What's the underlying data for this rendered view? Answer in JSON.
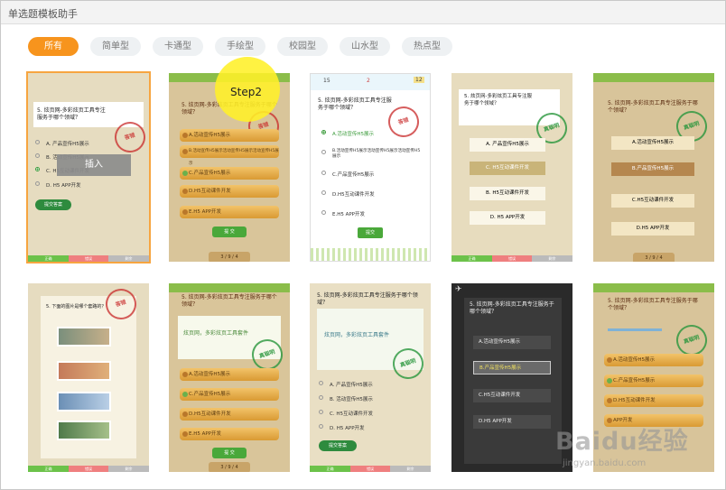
{
  "window": {
    "title": "单选题模板助手"
  },
  "tabs": [
    {
      "label": "所有"
    },
    {
      "label": "简单型"
    },
    {
      "label": "卡通型"
    },
    {
      "label": "手绘型"
    },
    {
      "label": "校园型"
    },
    {
      "label": "山水型"
    },
    {
      "label": "热点型"
    }
  ],
  "overlays": {
    "step_label": "Step2",
    "insert_label": "插入"
  },
  "question": "5. 炫页网-多彩炫页工具专注服务于哪个领域？",
  "question_short": "5. 下面的图片是哪个套路的？",
  "options_long": [
    "A. 产品宣传H5展示",
    "B. 活动宣传H5展示",
    "C. H5互动课件开发",
    "D. H5 APP开发"
  ],
  "options_wood1": [
    "A.活动宣传H5展示",
    "B.活动宣传H5展示活动宣传H5展示活动宣传H5展示",
    "C.产品宣传H5展示",
    "D.H5互动课件开发",
    "E.H5 APP开发"
  ],
  "options_card3": [
    "A.活动宣传H5展示",
    "B.活动宣传H5展示活动宣传H5展示活动宣传H5展示",
    "C.产品宣传H5展示",
    "D.H5互动课件开发",
    "E.H5 APP开发"
  ],
  "options_card4": [
    "A. 产品宣传H5展示",
    "C. H5互动课件开发",
    "B. H5互动课件开发",
    "D. H5 APP开发"
  ],
  "options_card5": [
    "A.活动宣传H5展示",
    "B.产品宣传H5展示",
    "C.H5互动课件开发",
    "D.H5 APP开发"
  ],
  "options_card7": [
    "A.活动宣传H5展示",
    "C.产品宣传H5展示",
    "D.H5互动课件开发",
    "E.H5 APP开发"
  ],
  "options_card9": [
    "A.活动宣传H5展示",
    "B.产品宣传H5展示",
    "C.H5互动课件开发",
    "D.H5 APP开发"
  ],
  "options_card10": [
    "A.活动宣传H5展示",
    "C.产品宣传H5展示",
    "D.H5互动课件开发",
    "APP开发"
  ],
  "submit_labels": {
    "submit": "提交答案",
    "submit_short": "提 交",
    "submit_card3": "提交"
  },
  "stamps": {
    "red": "答错",
    "green": "真聪明"
  },
  "pager": "3 / 9 / 4",
  "banner_text": "炫页网，多彩炫页工具套件",
  "timer": [
    "15",
    "2",
    "12"
  ],
  "bottom_bar": [
    "正确",
    "错误",
    "剩余"
  ],
  "watermark": {
    "logo": "Baidu经验",
    "url": "jingyan.baidu.com"
  }
}
